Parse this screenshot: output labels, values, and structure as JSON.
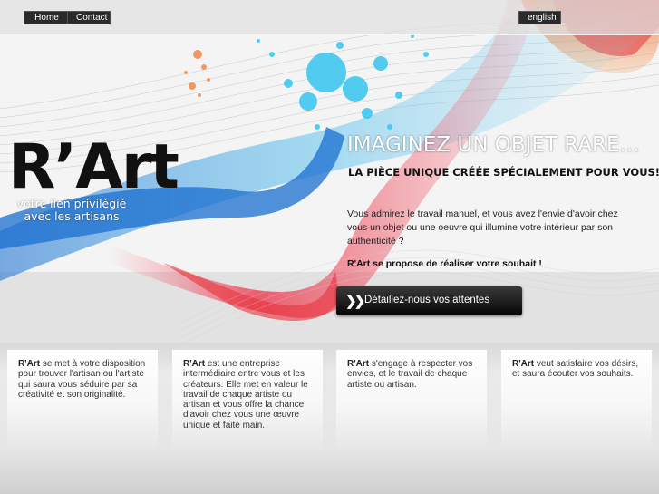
{
  "nav": {
    "home_label": "Home",
    "contact_label": "Contact",
    "language_label": "english"
  },
  "brand": {
    "name": "R’Art",
    "tagline_line1": "votre lien privilégié",
    "tagline_line2": "avec les artisans"
  },
  "hero": {
    "headline": "IMAGINEZ UN OBJET RARE...",
    "subheadline": "LA PIÈCE UNIQUE CRÉÉE SPÉCIALEMENT POUR VOUS!",
    "intro": "Vous admirez le travail manuel, et vous avez l'envie d'avoir chez vous un objet ou une oeuvre qui illumine votre intérieur par son authenticité ?",
    "promise": "R'Art se propose de réaliser votre souhait !",
    "cta_label": "Détaillez-nous vos attentes",
    "cta_icon": "double-chevron-right-icon"
  },
  "cards": [
    {
      "brand": "R'Art",
      "text": " se met à votre disposition pour trouver l'artisan ou l'artiste qui saura vous séduire par sa créativité et son originalité."
    },
    {
      "brand": "R'Art",
      "text": " est une entreprise intermédiaire entre vous et les créateurs. Elle met en valeur le travail de chaque artiste ou artisan et vous offre la chance d'avoir chez vous une œuvre unique et faite main."
    },
    {
      "brand": "R'Art",
      "text": " s'engage à respecter vos envies, et le travail de chaque artiste ou artisan."
    },
    {
      "brand": "R'Art",
      "text": " veut satisfaire vos désirs, et saura écouter vos souhaits."
    }
  ],
  "colors": {
    "accent_red": "#e8323c",
    "accent_blue": "#1a8fd8",
    "accent_cyan": "#35c6f0",
    "accent_orange": "#f0884a",
    "dark_button": "#111111"
  }
}
